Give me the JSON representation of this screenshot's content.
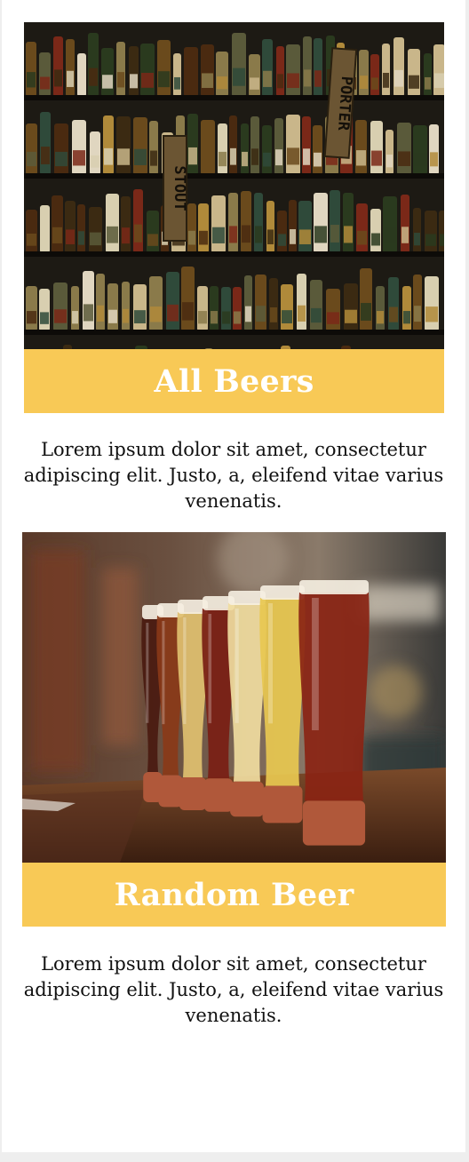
{
  "cards": [
    {
      "title": "All Beers",
      "description": "Lorem ipsum dolor sit amet, consectetur adipiscing elit. Justo, a, eleifend vitae varius venenatis.",
      "image_alt": "Shelves full of beer bottles with STOUT and PORTER signs",
      "shelf_signs": [
        "STOUT",
        "PORTER"
      ]
    },
    {
      "title": "Random Beer",
      "description": "Lorem ipsum dolor sit amet, consectetur adipiscing elit. Justo, a, eleifend vitae varius venenatis.",
      "image_alt": "A flight of beer glasses lined up on a bar counter"
    }
  ],
  "colors": {
    "banner": "#f8c956",
    "title_text": "#ffffff",
    "body_text": "#111111",
    "page_background": "#ffffff",
    "outer_background": "#eeeeee"
  }
}
